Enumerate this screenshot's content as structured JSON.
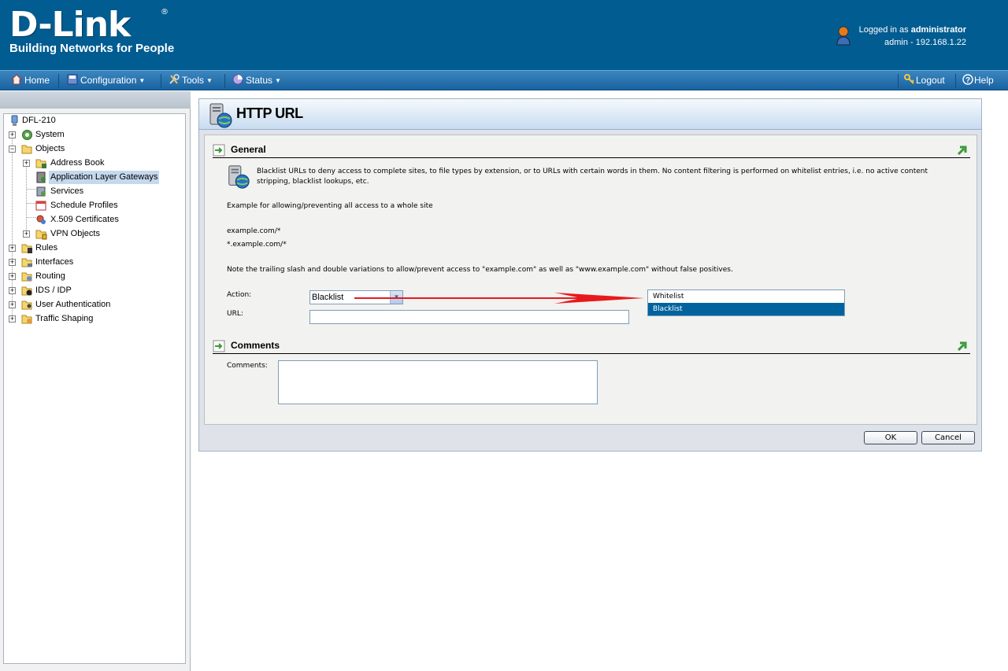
{
  "header": {
    "logo_main": "D-Link",
    "logo_reg": "®",
    "logo_tagline": "Building Networks for People",
    "login_prefix": "Logged in as ",
    "login_user": "administrator",
    "login_detail": "admin - 192.168.1.22"
  },
  "menubar": {
    "home": "Home",
    "configuration": "Configuration",
    "tools": "Tools",
    "status": "Status",
    "logout": "Logout",
    "help": "Help"
  },
  "tree": {
    "root": "DFL-210",
    "items": [
      {
        "label": "System"
      },
      {
        "label": "Objects"
      },
      {
        "label": "Address Book"
      },
      {
        "label": "Application Layer Gateways"
      },
      {
        "label": "Services"
      },
      {
        "label": "Schedule Profiles"
      },
      {
        "label": "X.509 Certificates"
      },
      {
        "label": "VPN Objects"
      },
      {
        "label": "Rules"
      },
      {
        "label": "Interfaces"
      },
      {
        "label": "Routing"
      },
      {
        "label": "IDS / IDP"
      },
      {
        "label": "User Authentication"
      },
      {
        "label": "Traffic Shaping"
      }
    ]
  },
  "page": {
    "title": "HTTP URL",
    "general": {
      "heading": "General",
      "description_line1": "Blacklist URLs to deny access to complete sites, to file types by extension, or to URLs with certain words in them. No content filtering is performed on whitelist entries, i.e. no active content",
      "description_line2": "stripping, blacklist lookups, etc.",
      "example_heading": "Example for allowing/preventing all access to a whole site",
      "example1": "example.com/*",
      "example2": "*.example.com/*",
      "note": "Note the trailing slash and double variations to allow/prevent access to \"example.com\" as well as \"www.example.com\" without false positives.",
      "action_label": "Action:",
      "action_value": "Blacklist",
      "url_label": "URL:",
      "url_value": "",
      "action_options": [
        "Whitelist",
        "Blacklist"
      ]
    },
    "comments": {
      "heading": "Comments",
      "label": "Comments:",
      "value": ""
    },
    "buttons": {
      "ok": "OK",
      "cancel": "Cancel"
    }
  },
  "colors": {
    "header_bg": "#005c91",
    "menubar_bg": "#1862a0",
    "selection_bg": "#00639e",
    "arrow": "#e8191c"
  }
}
